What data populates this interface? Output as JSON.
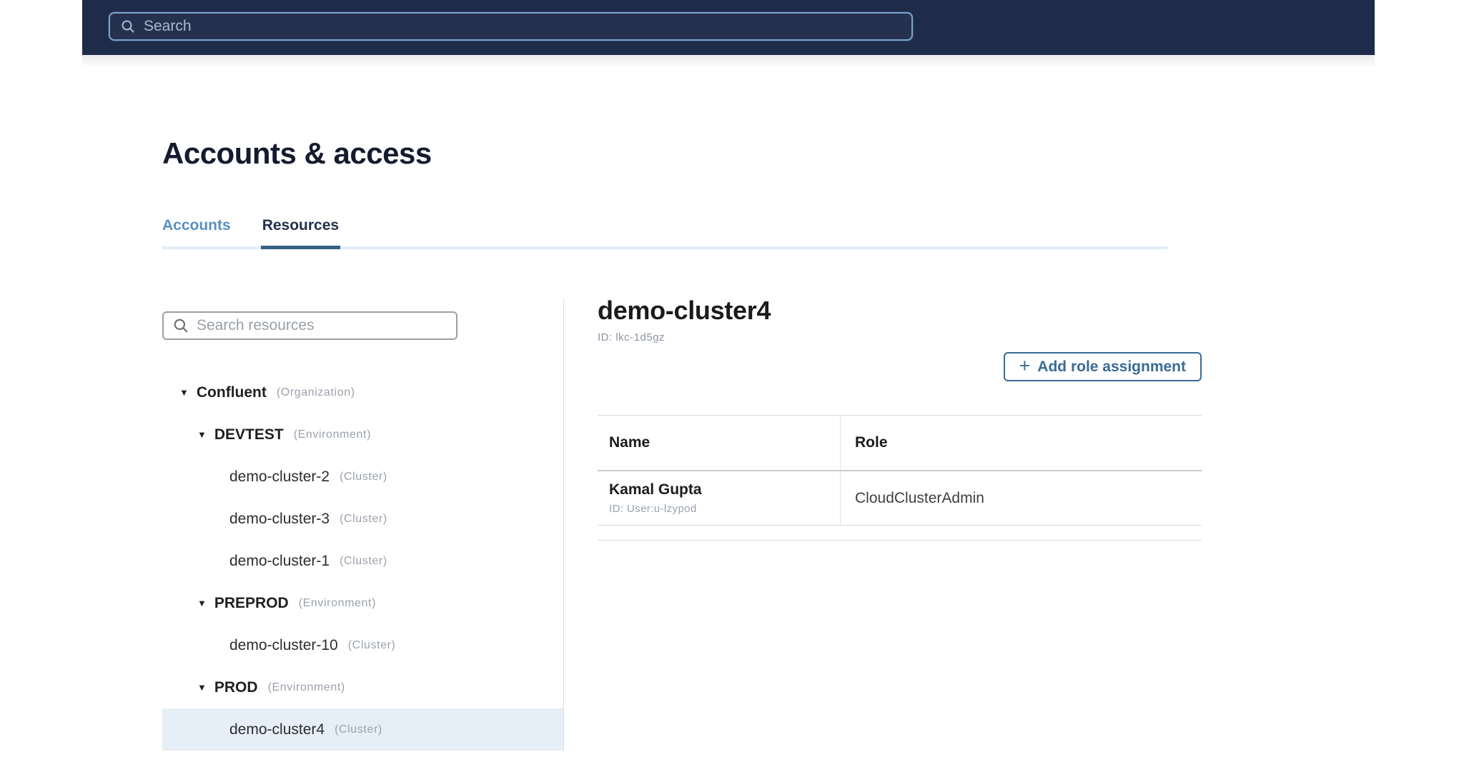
{
  "topnav": {
    "search_placeholder": "Search",
    "search_value": ""
  },
  "page": {
    "title": "Accounts & access",
    "tabs": [
      {
        "label": "Accounts",
        "active": false
      },
      {
        "label": "Resources",
        "active": true
      }
    ]
  },
  "resource_tree": {
    "search_placeholder": "Search resources",
    "search_value": "",
    "items": [
      {
        "label": "Confluent",
        "type": "(Organization)",
        "level": 0,
        "expanded": true,
        "selected": false
      },
      {
        "label": "DEVTEST",
        "type": "(Environment)",
        "level": 1,
        "expanded": true,
        "selected": false
      },
      {
        "label": "demo-cluster-2",
        "type": "(Cluster)",
        "level": 2,
        "expanded": false,
        "selected": false
      },
      {
        "label": "demo-cluster-3",
        "type": "(Cluster)",
        "level": 2,
        "expanded": false,
        "selected": false
      },
      {
        "label": "demo-cluster-1",
        "type": "(Cluster)",
        "level": 2,
        "expanded": false,
        "selected": false
      },
      {
        "label": "PREPROD",
        "type": "(Environment)",
        "level": 1,
        "expanded": true,
        "selected": false
      },
      {
        "label": "demo-cluster-10",
        "type": "(Cluster)",
        "level": 2,
        "expanded": false,
        "selected": false
      },
      {
        "label": "PROD",
        "type": "(Environment)",
        "level": 1,
        "expanded": true,
        "selected": false
      },
      {
        "label": "demo-cluster4",
        "type": "(Cluster)",
        "level": 2,
        "expanded": false,
        "selected": true
      }
    ]
  },
  "detail": {
    "title": "demo-cluster4",
    "id_label": "ID: lkc-1d5gz",
    "add_button_label": "Add role assignment",
    "add_button_plus": "+",
    "table": {
      "columns": [
        "Name",
        "Role"
      ],
      "rows": [
        {
          "name": "Kamal Gupta",
          "id": "ID: User:u-lzypod",
          "role": "CloudClusterAdmin"
        }
      ]
    }
  },
  "colors": {
    "navbar_bg": "#1e2b49",
    "nav_search_border": "#7ba1c9",
    "tab_inactive_text": "#5b8fc0",
    "tab_active_text": "#24304c",
    "tab_active_underline": "#366084",
    "tab_track": "#e3edf6",
    "selected_row_bg": "#e6eef7",
    "accent_button": "#3a6b96",
    "muted_text": "#9ba1ac"
  }
}
